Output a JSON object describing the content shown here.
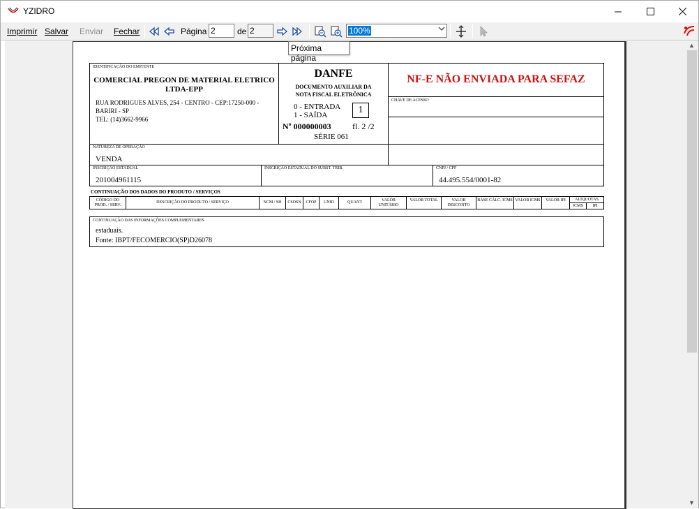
{
  "window": {
    "title": "YZIDRO"
  },
  "toolbar": {
    "print": "Imprimir",
    "save": "Salvar",
    "send": "Enviar",
    "close": "Fechar",
    "page_label": "Página",
    "page_value": "2",
    "of_label": "de",
    "total_pages": "2",
    "zoom": "100%",
    "tooltip": "Próxima página"
  },
  "danfe": {
    "emitter_label": "Identificação do emitente",
    "emitter_name": "COMERCIAL PREGON DE MATERIAL ELETRICO LTDA-EPP",
    "address1": "RUA RODRIGUES ALVES, 254 - CENTRO - CEP:17250-000 -",
    "address2": "BARIRI - SP",
    "phone": "TEL: (14)3662-9966",
    "title": "DANFE",
    "subtitle1": "DOCUMENTO AUXILIAR DA",
    "subtitle2": "NOTA FISCAL ELETRÔNICA",
    "entry": "0 - ENTRADA",
    "exit": "1 - SAÍDA",
    "type_value": "1",
    "number": "Nº 000000003",
    "sheet": "fl. 2 /2",
    "series": "SÉRIE 061",
    "status": "NF-E NÃO ENVIADA PARA SEFAZ",
    "access_key_label": "Chave de acesso",
    "nature_label": "Natureza de operação",
    "nature_value": "VENDA",
    "state_reg_label": "Inscrição estadual",
    "state_reg_value": "201004961115",
    "subst_label": "Inscrição estadual do subst. trib.",
    "cnpj_label": "CNPJ / CPF",
    "cnpj_value": "44.495.554/0001-82",
    "products_title": "CONTINUAÇÃO DOS DADOS DO PRODUTO / SERVIÇOS",
    "columns": [
      "CÓDIGO DO PROD. / SERV.",
      "DESCRIÇÃO DO PRODUTO / SERVIÇO",
      "NCM / SH",
      "CSOSN",
      "CFOP",
      "UNID",
      "QUANT",
      "VALOR UNITÁRIO",
      "VALOR TOTAL",
      "VALOR DESCONTO",
      "BASE CÁLC. ICMS",
      "VALOR ICMS",
      "VALOR IPI",
      "ALÍQUOTAS"
    ],
    "aliq_icms": "ICMS",
    "aliq_ipi": "IPI",
    "info_label": "Continuação das informações complementares",
    "info_line1": "estaduais.",
    "info_line2": "Fonte: IBPT/FECOMERCIO(SP)D26078"
  },
  "colors": {
    "status_red": "#cc1111",
    "selection": "#0078d7"
  }
}
